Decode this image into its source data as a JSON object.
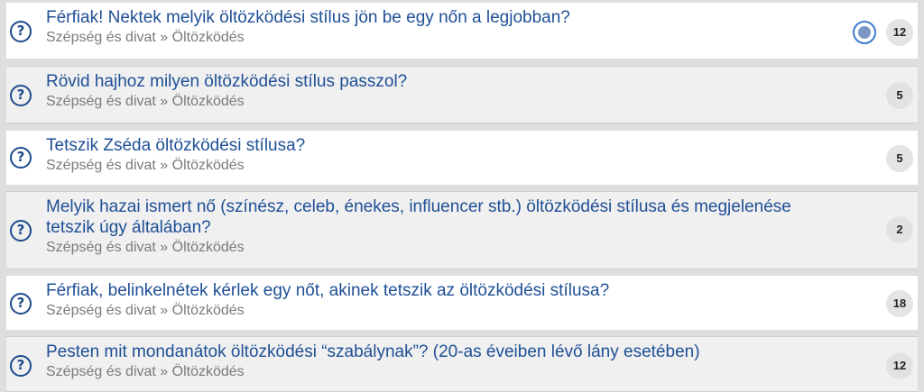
{
  "questions": [
    {
      "title": "Férfiak! Nektek melyik öltözködési stílus jön be egy nőn a legjobban?",
      "category": "Szépség és divat » Öltözködés",
      "answers": "12",
      "icon": "question-circle-icon"
    },
    {
      "title": "Rövid hajhoz milyen öltözködési stílus passzol?",
      "category": "Szépség és divat » Öltözködés",
      "answers": "5",
      "icon": "question-circle-icon"
    },
    {
      "title": "Tetszik Zséda öltözködési stílusa?",
      "category": "Szépség és divat » Öltözködés",
      "answers": "5",
      "icon": "question-circle-icon"
    },
    {
      "title": "Melyik hazai ismert nő (színész, celeb, énekes, influencer stb.) öltözködési stílusa és megjelenése tetszik úgy általában?",
      "category": "Szépség és divat » Öltözködés",
      "answers": "2",
      "icon": "question-circle-icon"
    },
    {
      "title": "Férfiak, belinkelnétek kérlek egy nőt, akinek tetszik az öltözködési stílusa?",
      "category": "Szépség és divat » Öltözködés",
      "answers": "18",
      "icon": "question-circle-icon"
    },
    {
      "title": "Pesten mit mondanátok öltözködési “szabálynak”? (20-as éveiben lévő lány esetében)",
      "category": "Szépség és divat » Öltözködés",
      "answers": "12",
      "icon": "question-circle-icon"
    }
  ],
  "colors": {
    "title": "#1f4f96",
    "icon": "#1b4a8c",
    "meta": "#7a7a7a"
  }
}
